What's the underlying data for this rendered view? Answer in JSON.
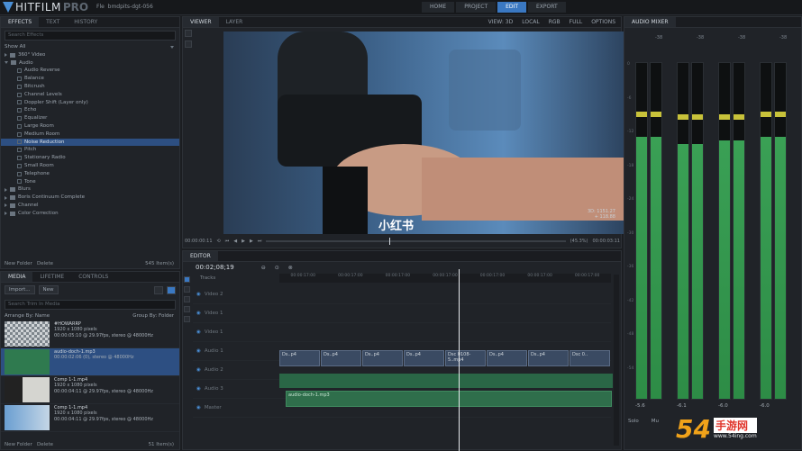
{
  "app": {
    "name": "HITFILM",
    "edition": "PRO",
    "file_label": "Fle",
    "project_name": "bmdpits-dgt-056"
  },
  "modes": [
    {
      "label": "HOME"
    },
    {
      "label": "PROJECT"
    },
    {
      "label": "EDIT"
    },
    {
      "label": "EXPORT"
    }
  ],
  "effects_panel": {
    "tabs": [
      "EFFECTS",
      "TEXT",
      "HISTORY"
    ],
    "search_placeholder": "Search Effects",
    "show_label": "Show All",
    "items": [
      {
        "label": "360° Video",
        "type": "folder",
        "expanded": false
      },
      {
        "label": "Audio",
        "type": "folder",
        "expanded": true
      },
      {
        "label": "Audio Reverse",
        "type": "effect"
      },
      {
        "label": "Balance",
        "type": "effect"
      },
      {
        "label": "Bitcrush",
        "type": "effect"
      },
      {
        "label": "Channel Levels",
        "type": "effect"
      },
      {
        "label": "Doppler Shift (Layer only)",
        "type": "effect"
      },
      {
        "label": "Echo",
        "type": "effect"
      },
      {
        "label": "Equalizer",
        "type": "effect"
      },
      {
        "label": "Large Room",
        "type": "effect"
      },
      {
        "label": "Medium Room",
        "type": "effect"
      },
      {
        "label": "Noise Reduction",
        "type": "effect",
        "selected": true
      },
      {
        "label": "Pitch",
        "type": "effect"
      },
      {
        "label": "Stationary Radio",
        "type": "effect"
      },
      {
        "label": "Small Room",
        "type": "effect"
      },
      {
        "label": "Telephone",
        "type": "effect"
      },
      {
        "label": "Tone",
        "type": "effect"
      },
      {
        "label": "Blurs",
        "type": "folder",
        "expanded": false
      },
      {
        "label": "Boris Continuum Complete",
        "type": "folder",
        "expanded": false
      },
      {
        "label": "Channel",
        "type": "folder",
        "expanded": false
      },
      {
        "label": "Color Correction",
        "type": "folder",
        "expanded": false
      }
    ],
    "new_folder": "New Folder",
    "delete": "Delete",
    "count": "545 Item(s)"
  },
  "media_panel": {
    "tabs": [
      "MEDIA",
      "LIFETIME",
      "CONTROLS"
    ],
    "import_label": "Import...",
    "new_label": "New",
    "search_placeholder": "Search Trim In Media",
    "arrange_label": "Arrange By: Name",
    "group_label": "Group By: Folder",
    "items": [
      {
        "title": "#HOWARRP",
        "line1": "1920 x 1080 pixels",
        "line2": "00:00:05:10 @ 29.97fps, stereo @ 48000Hz",
        "thumb": "checker"
      },
      {
        "title": "audio-doch-1.mp3",
        "line1": "00:00:02:06 (0), stereo @ 48000Hz",
        "line2": "",
        "thumb": "green",
        "selected": true
      },
      {
        "title": "Comp 1-1.mp4",
        "line1": "1920 x 1080 pixels",
        "line2": "00:00:04:11 @ 29.97fps, stereo @ 48000Hz",
        "thumb": "studio"
      },
      {
        "title": "Comp 1-1.mp4",
        "line1": "1920 x 1080 pixels",
        "line2": "00:00:04:11 @ 29.97fps, stereo @ 48000Hz",
        "thumb": "blue"
      }
    ],
    "new_folder": "New Folder",
    "delete": "Delete",
    "count": "51 Item(s)"
  },
  "viewer": {
    "tabs": [
      "VIEWER",
      "LAYER"
    ],
    "options": [
      "VIEW: 3D",
      "LOCAL",
      "RGB",
      "FULL",
      "OPTIONS"
    ],
    "watermark": "小红书",
    "timecode_left": "00:00:00:11",
    "timecode_right": "00:00:03:11",
    "side_info_1": "3D: 1151.27",
    "side_info_2": "+ 118.88",
    "zoom": "(45.3%)"
  },
  "editor": {
    "title": "EDITOR",
    "timecode": "00:02;08;19",
    "tracks_label": "Tracks",
    "ruler": [
      "00:00:17:00",
      "00:00:17:00",
      "00:00:17:00",
      "00:00:17:00",
      "00:00:17:00",
      "00:00:17:00",
      "00:00:17:00"
    ],
    "tracks": [
      {
        "name": "Video 2"
      },
      {
        "name": "Video 1"
      },
      {
        "name": "Video 1"
      },
      {
        "name": "Audio 1"
      },
      {
        "name": "Audio 2"
      },
      {
        "name": "Audio 3"
      },
      {
        "name": "Master"
      }
    ],
    "video_clips": [
      "Ds..p4",
      "Ds..p4",
      "Ds..p4",
      "Ds..p4",
      "Dsc 0108-5..mp4",
      "Ds..p4",
      "Ds..p4",
      "Dsc 0.."
    ],
    "audio_clip": "audio-doch-1.mp3"
  },
  "mixer": {
    "title": "AUDIO MIXER",
    "channels": [
      {
        "top": "-38",
        "db": "-5.6",
        "level": 0.78,
        "peak": 0.84
      },
      {
        "top": "-38",
        "db": "-6.1",
        "level": 0.76,
        "peak": 0.83
      },
      {
        "top": "-38",
        "db": "-6.0",
        "level": 0.77,
        "peak": 0.83
      },
      {
        "top": "-38",
        "db": "-6.0",
        "level": 0.78,
        "peak": 0.84
      }
    ],
    "scale": [
      "0",
      "-6",
      "-12",
      "-18",
      "-24",
      "-30",
      "-36",
      "-42",
      "-48",
      "-54"
    ],
    "solo_label": "Solo",
    "mute_label": "Mu"
  },
  "brand_watermark": {
    "text": "54手游网",
    "url": "www.54ing.com",
    "colors": {
      "accent": "#f0a21a",
      "red": "#e0352b"
    }
  }
}
